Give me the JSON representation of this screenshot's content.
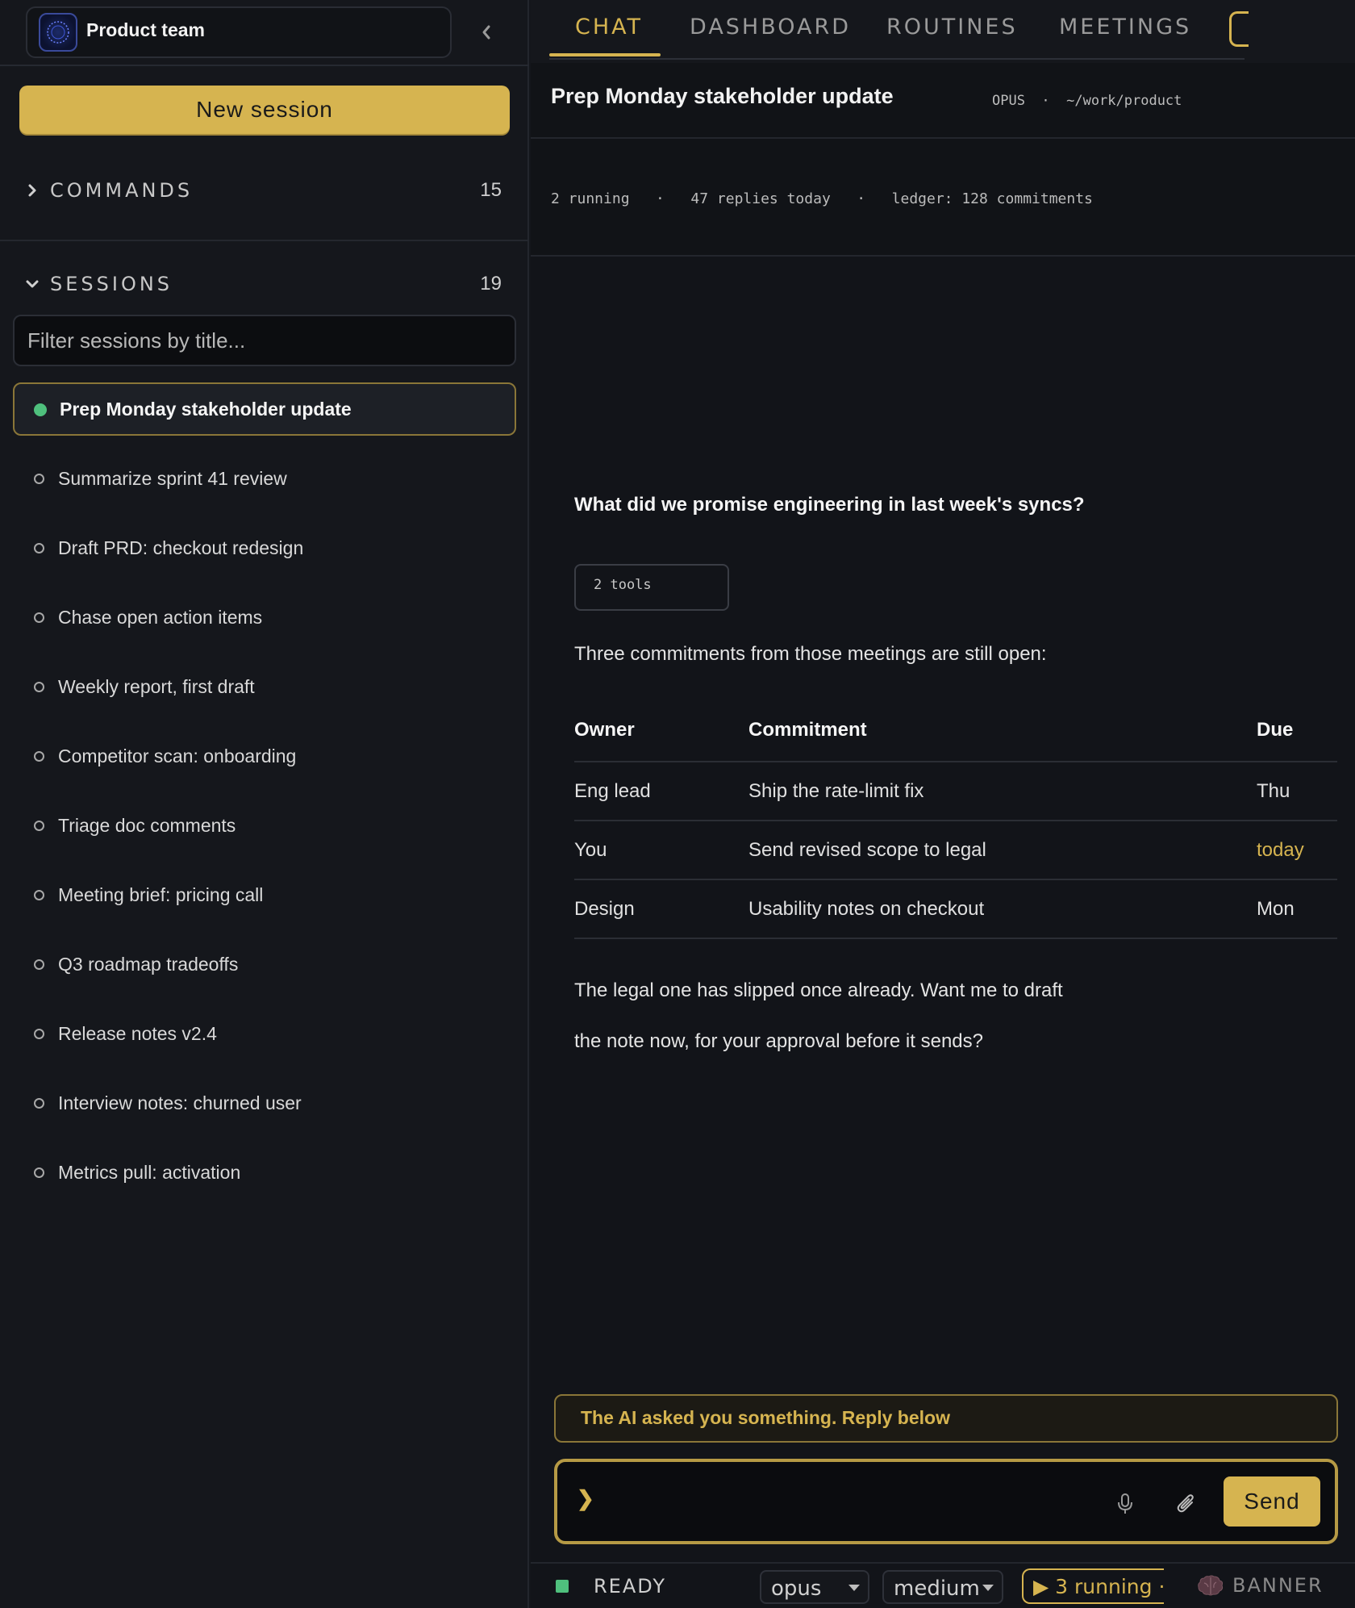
{
  "sidebar": {
    "team_name": "Product team",
    "new_session_label": "New session",
    "commands": {
      "title": "COMMANDS",
      "count": "15",
      "expanded": false
    },
    "sessions": {
      "title": "SESSIONS",
      "count": "19",
      "expanded": true,
      "filter_placeholder": "Filter sessions by title...",
      "filter_value": "",
      "items": [
        {
          "label": "Prep Monday stakeholder update",
          "active": true
        },
        {
          "label": "Summarize sprint 41 review",
          "active": false
        },
        {
          "label": "Draft PRD: checkout redesign",
          "active": false
        },
        {
          "label": "Chase open action items",
          "active": false
        },
        {
          "label": "Weekly report, first draft",
          "active": false
        },
        {
          "label": "Competitor scan: onboarding",
          "active": false
        },
        {
          "label": "Triage doc comments",
          "active": false
        },
        {
          "label": "Meeting brief: pricing call",
          "active": false
        },
        {
          "label": "Q3 roadmap tradeoffs",
          "active": false
        },
        {
          "label": "Release notes v2.4",
          "active": false
        },
        {
          "label": "Interview notes: churned user",
          "active": false
        },
        {
          "label": "Metrics pull: activation",
          "active": false
        }
      ]
    }
  },
  "tabs": [
    {
      "label": "CHAT",
      "active": true
    },
    {
      "label": "DASHBOARD",
      "active": false
    },
    {
      "label": "ROUTINES",
      "active": false
    },
    {
      "label": "MEETINGS",
      "active": false
    }
  ],
  "thread": {
    "title": "Prep Monday stakeholder update",
    "meta": "OPUS  ·  ~/work/product",
    "stats": "2 running   ·   47 replies today   ·   ledger: 128 commitments"
  },
  "conversation": {
    "question": "What did we promise engineering in last week's syncs?",
    "tools_chip": "2 tools",
    "intro": "Three commitments from those meetings are still open:",
    "table": {
      "headers": [
        "Owner",
        "Commitment",
        "Due"
      ],
      "rows": [
        {
          "owner": "Eng lead",
          "commitment": "Ship the rate-limit fix",
          "due": "Thu"
        },
        {
          "owner": "You",
          "commitment": "Send revised scope to legal",
          "due": "today"
        },
        {
          "owner": "Design",
          "commitment": "Usability notes on checkout",
          "due": "Mon"
        }
      ]
    },
    "followup_line1": "The legal one has slipped once already. Want me to draft",
    "followup_line2": "the note now, for your approval before it sends?"
  },
  "notice": "The AI asked you something. Reply below",
  "composer": {
    "prompt_glyph": "❯",
    "value": "",
    "send_label": "Send"
  },
  "statusbar": {
    "state": "READY",
    "model": "opus",
    "effort": "medium",
    "running": "▶ 3 running ·",
    "banner": "BANNER"
  },
  "colors": {
    "accent": "#d6b450",
    "ready": "#4fc07d",
    "background": "#14161b"
  },
  "icons": {
    "collapse": "chevron-left-icon",
    "section_collapsed": "chevron-right-icon",
    "section_expanded": "chevron-down-icon",
    "mic": "microphone-icon",
    "attach": "paperclip-icon",
    "banner": "brain-icon"
  }
}
